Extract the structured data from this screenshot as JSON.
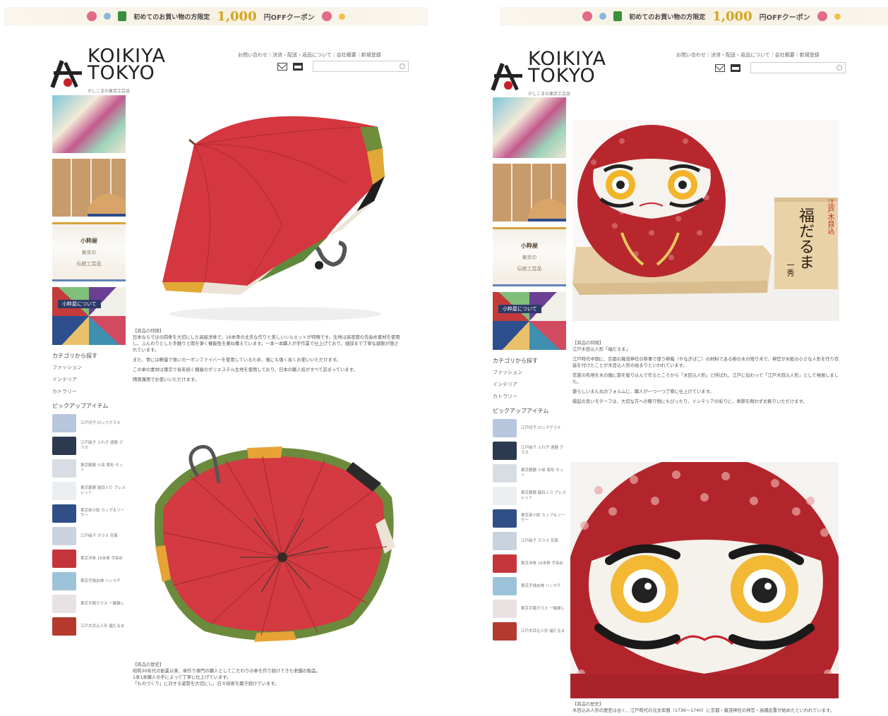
{
  "banner": {
    "small_text": "初めてのお買い物の方限定",
    "amount": "1,000",
    "unit": "円OFFクーポン"
  },
  "site": {
    "logo_line1": "KOIKIYA",
    "logo_line2": "TOKYO",
    "logo_tag": "かしこまの東京工芸品",
    "nav": "お問い合わせ｜決済・配送・返品について｜会社概要｜新規登録",
    "search_placeholder": ""
  },
  "sidebar": {
    "feature_brand": "小粋屋",
    "feature_line1": "東京の",
    "feature_line2": "伝統工芸品",
    "about_caption": "小粋屋について",
    "category_heading": "カテゴリから探す",
    "categories": [
      "ファッション",
      "インテリア",
      "カトラリー"
    ],
    "pickup_heading": "ピックアップアイテム",
    "pickup_items": [
      "江戸切子 ロックグラス",
      "江戸硝子 入れ子 酒器 グラス",
      "東京銀器 小皿 菊形 セット",
      "東京銀器 鎚目入り ブレスレット",
      "東京染小紋 カップ＆ソーサー",
      "江戸硝子 ガラス 花瓶",
      "東京洋傘 16本骨 手染め",
      "東京手描友禅 ハンカチ",
      "東京手織ガラス 一輪挿し",
      "江戸木目込人形 福だるま"
    ]
  },
  "left_article": {
    "feature_head": "【商品の特徴】",
    "feature_p1": "日本ならではの四季を大切にした高級洋傘で、16本骨の丈夫な作りと美しいシルエットが特徴です。生地は高密度の先染め素材を使用し、ふんわりとした手触りと雨を弾く機能性を兼ね備えています。一本一本職人が手作業で仕上げており、細部まで丁寧な縫製が施されています。",
    "feature_p2": "また、骨には軽量で強いカーボンファイバーを使用しているため、風にも強く長くお使いいただけます。",
    "feature_p3": "この傘の素材は東京で長年続く機屋のポリエステル生地を使用しており、日本の職人技がすべて詰まっています。",
    "feature_p4": "晴雨兼用でお使いいただけます。",
    "history_head": "【商品の歴史】",
    "history_p1": "昭和30年代の創業以来、傘作り専門の職人としてこだわりの傘を作り続けてきた老舗の製品。",
    "history_p2": "1本1本職人の手によって丁寧に仕上げています。",
    "history_p3": "「ものづくり」に対する姿勢を大切にし、日々技術を磨き続けています。"
  },
  "right_article": {
    "box_line1": "江戸木目込",
    "box_line2": "福だるま",
    "box_line3": "一秀",
    "feature_head": "【商品の特徴】",
    "feature_p1": "江戸木目込人形「福だるま」",
    "feature_p2": "江戸時代中期に、京都の賀茂神社の祭事で使う柳箱（やなぎばこ）の材料である柳の木の残り木で、神官が木彫の小さな人形を作り衣装を付けたことが木目込人形の始まりといわれています。",
    "feature_p3": "衣裳の布地を木の胴に筋を彫り込んで作るところから「木目込人形」と呼ばれ、江戸に伝わって「江戸木目込人形」として発展しました。",
    "feature_p4": "愛らしいまん丸のフォルムに、職人が一つ一つ丁寧に仕上げています。",
    "feature_p5": "縁起の良いモチーフは、大切な方への贈り物にもぴったり。インテリアの彩りに、季節を問わずお飾りいただけます。",
    "history_head": "【商品の歴史】",
    "history_p1": "木目込み人形の歴史は古く、江戸時代の元文年間（1736〜1740）に京都・賀茂神社の神官・高橋忠重が始めたといわれています。"
  }
}
